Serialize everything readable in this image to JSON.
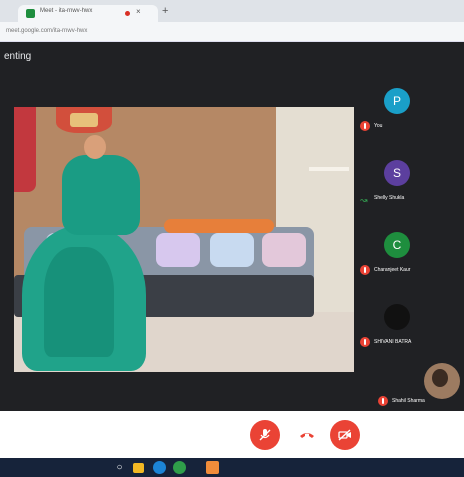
{
  "browser": {
    "tab_title": "Meet - ita-rnwv-hwx",
    "tab_close": "×",
    "new_tab": "+",
    "url": "meet.google.com/ita-rnwv-hwx"
  },
  "meeting": {
    "presenting_label": "enting",
    "participants": [
      {
        "initial": "P",
        "name": "You",
        "avatar_color": "#1a9fc8",
        "mic": "muted"
      },
      {
        "initial": "S",
        "name": "Shelly Shukla",
        "avatar_color": "#5c3f9e",
        "mic": "speaking"
      },
      {
        "initial": "C",
        "name": "Charanjeet Kaur",
        "avatar_color": "#1e8e3e",
        "mic": "muted"
      },
      {
        "initial": "",
        "name": "SHIVANI BATRA",
        "avatar_color": "#111111",
        "mic": "muted"
      },
      {
        "initial": "",
        "name": "Shahil Sharma",
        "avatar_color": "photo",
        "mic": "muted"
      }
    ]
  },
  "controls": {
    "mic_icon": "mic-off-icon",
    "end_call_icon": "phone-hangup-icon",
    "camera_icon": "camera-off-icon",
    "accent_red": "#ea4335"
  },
  "taskbar": {
    "icons": [
      "search-icon",
      "file-explorer-icon",
      "edge-icon",
      "chrome-icon",
      "powerpoint-icon"
    ]
  }
}
